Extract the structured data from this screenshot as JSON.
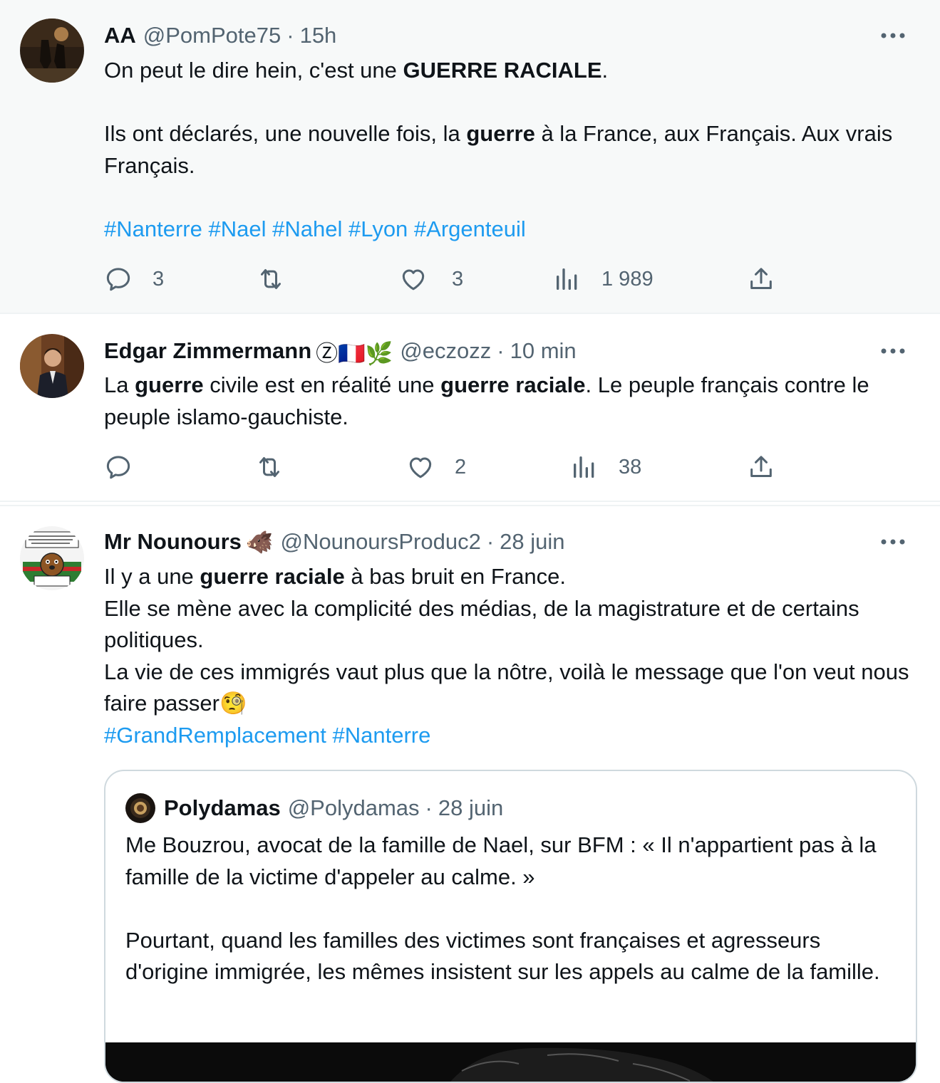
{
  "tweets": [
    {
      "name": "AA",
      "handle": "@PomPote75",
      "separator": "·",
      "time": "15h",
      "text": {
        "p1_pre": "On peut le dire hein, c'est une ",
        "p1_bold": "GUERRE RACIALE",
        "p1_post": ".",
        "p2_pre": "Ils ont déclarés, une nouvelle fois, la ",
        "p2_bold": "guerre",
        "p2_post": " à la France, aux Français. Aux vrais Français.",
        "hashtags": [
          "#Nanterre",
          "#Nael",
          "#Nahel",
          "#Lyon",
          "#Argenteuil"
        ]
      },
      "stats": {
        "replies": "3",
        "retweets": "",
        "likes": "3",
        "views": "1 989"
      }
    },
    {
      "name": "Edgar Zimmermann",
      "badges": "Ⓩ🇫🇷🌿",
      "handle": "@eczozz",
      "separator": "·",
      "time": "10 min",
      "text": {
        "s1": "La ",
        "b1": "guerre",
        "s2": " civile est en réalité une ",
        "b2": "guerre raciale",
        "s3": ". Le peuple français contre le peuple islamo-gauchiste."
      },
      "stats": {
        "replies": "",
        "retweets": "",
        "likes": "2",
        "views": "38"
      }
    },
    {
      "name": "Mr Nounours",
      "badges": "🐗",
      "handle": "@NounoursProduc2",
      "separator": "·",
      "time": "28 juin",
      "text": {
        "l1_pre": "Il y a une ",
        "l1_bold": "guerre raciale",
        "l1_post": " à bas bruit en France.",
        "l2": "Elle se mène avec la complicité des médias, de la magistrature et de certains politiques.",
        "l3": "La vie de ces immigrés vaut plus que la nôtre, voilà le message que l'on veut nous faire passer🧐",
        "hashtags": [
          "#GrandRemplacement",
          "#Nanterre"
        ]
      },
      "quote": {
        "name": "Polydamas",
        "handle": "@Polydamas",
        "separator": "·",
        "time": "28 juin",
        "p1": "Me Bouzrou, avocat de la famille de Nael, sur BFM : « Il n'appartient pas à la famille de la victime d'appeler au calme. »",
        "p2": "Pourtant, quand les familles des victimes sont françaises et agresseurs d'origine immigrée, les mêmes insistent sur les appels au calme de la famille."
      }
    }
  ],
  "icons": [
    "reply-icon",
    "retweet-icon",
    "like-icon",
    "views-icon",
    "share-icon",
    "more-icon"
  ],
  "colors": {
    "hashtag": "#1d9bf0",
    "secondary_text": "#536471",
    "highlight_bg": "#f7f9f9",
    "border": "#cfd9de"
  }
}
